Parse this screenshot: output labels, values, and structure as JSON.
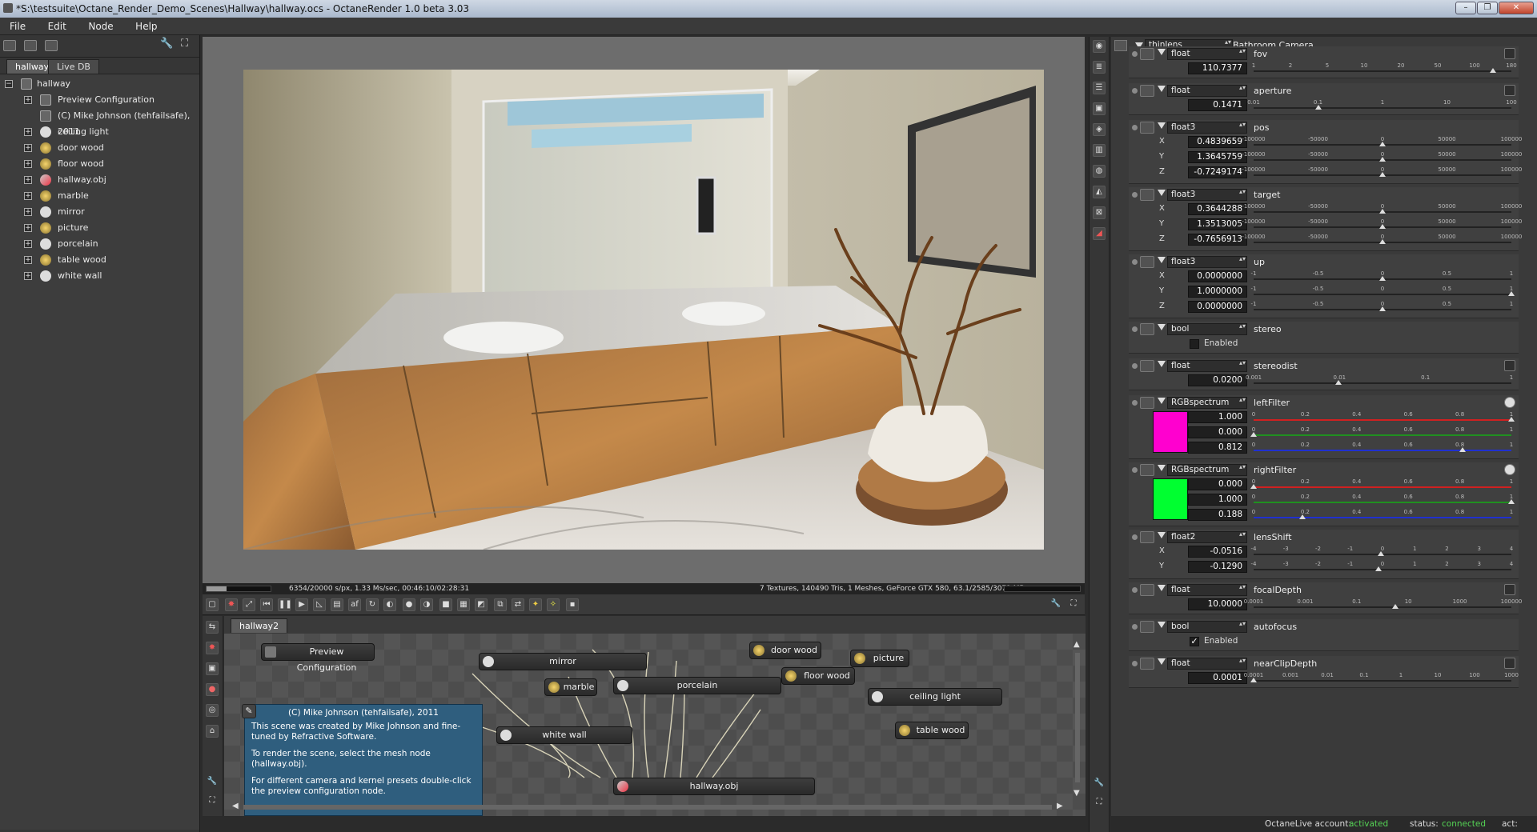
{
  "window": {
    "title": "*S:\\testsuite\\Octane_Render_Demo_Scenes\\Hallway\\hallway.ocs - OctaneRender 1.0 beta 3.03",
    "buttons": [
      "–",
      "❐",
      "✕"
    ]
  },
  "menu": [
    "File",
    "Edit",
    "Node",
    "Help"
  ],
  "left": {
    "tabs": [
      "hallway",
      "Live DB"
    ],
    "root": "hallway",
    "items": [
      {
        "label": "Preview Configuration",
        "icon": "config-node-icon",
        "expandable": true
      },
      {
        "label": "(C) Mike Johnson (tehfailsafe), 2011",
        "icon": "comment-icon",
        "expandable": false
      },
      {
        "label": "ceiling light",
        "icon": "material-sphere-icon",
        "expandable": true
      },
      {
        "label": "door wood",
        "icon": "texture-icon",
        "expandable": true
      },
      {
        "label": "floor wood",
        "icon": "texture-icon",
        "expandable": true
      },
      {
        "label": "hallway.obj",
        "icon": "mesh-icon",
        "expandable": true
      },
      {
        "label": "marble",
        "icon": "texture-icon",
        "expandable": true
      },
      {
        "label": "mirror",
        "icon": "material-sphere-icon",
        "expandable": true
      },
      {
        "label": "picture",
        "icon": "texture-icon",
        "expandable": true
      },
      {
        "label": "porcelain",
        "icon": "material-sphere-icon",
        "expandable": true
      },
      {
        "label": "table wood",
        "icon": "texture-icon",
        "expandable": true
      },
      {
        "label": "white wall",
        "icon": "material-sphere-icon",
        "expandable": true
      }
    ]
  },
  "viewport": {
    "status_left": "6354/20000 s/px, 1.33 Ms/sec, 00:46:10/02:28:31",
    "status_right": "7 Textures, 140490 Tris, 1 Meshes, GeForce GTX 580, 63.1/2585/3071 MB",
    "progress": 0.3177
  },
  "graph": {
    "tab": "hallway2",
    "nodes": [
      {
        "label": "Preview Configuration"
      },
      {
        "label": "mirror"
      },
      {
        "label": "door wood"
      },
      {
        "label": "picture"
      },
      {
        "label": "marble"
      },
      {
        "label": "porcelain"
      },
      {
        "label": "floor wood"
      },
      {
        "label": "ceiling light"
      },
      {
        "label": "white wall"
      },
      {
        "label": "table wood"
      },
      {
        "label": "hallway.obj"
      }
    ],
    "comment": {
      "title": "(C) Mike Johnson (tehfailsafe), 2011",
      "p1": "This scene was created by Mike Johnson and fine-tuned by Refractive Software.",
      "p2": "To render the scene, select the mesh node (hallway.obj).",
      "p3": "For different camera and kernel presets double-click the preview configuration node."
    }
  },
  "camera": {
    "type": "thinlens",
    "name": "Bathroom Camera"
  },
  "params": {
    "fov": {
      "type": "float",
      "name": "fov",
      "value": "110.7377",
      "ticks": [
        "1",
        "2",
        "5",
        "10",
        "20",
        "50",
        "100",
        "180"
      ]
    },
    "aperture": {
      "type": "float",
      "name": "aperture",
      "value": "0.1471",
      "ticks": [
        "0.01",
        "0.1",
        "1",
        "10",
        "100"
      ]
    },
    "pos": {
      "type": "float3",
      "name": "pos",
      "x": "0.4839659",
      "y": "1.3645759",
      "z": "-0.7249174"
    },
    "target": {
      "type": "float3",
      "name": "target",
      "x": "0.3644288",
      "y": "1.3513005",
      "z": "-0.7656913"
    },
    "up": {
      "type": "float3",
      "name": "up",
      "x": "0.0000000",
      "y": "1.0000000",
      "z": "0.0000000"
    },
    "stereo": {
      "type": "bool",
      "name": "stereo",
      "label": "Enabled",
      "checked": false
    },
    "stereodist": {
      "type": "float",
      "name": "stereodist",
      "value": "0.0200",
      "ticks": [
        "0.001",
        "0.01",
        "0.1",
        "1"
      ]
    },
    "leftFilter": {
      "type": "RGBspectrum",
      "name": "leftFilter",
      "r": "1.000",
      "g": "0.000",
      "b": "0.812",
      "color": "#ff00cf"
    },
    "rightFilter": {
      "type": "RGBspectrum",
      "name": "rightFilter",
      "r": "0.000",
      "g": "1.000",
      "b": "0.188",
      "color": "#00ff30"
    },
    "lensShift": {
      "type": "float2",
      "name": "lensShift",
      "x": "-0.0516",
      "y": "-0.1290",
      "ticks": [
        "-4",
        "-3",
        "-2",
        "-1",
        "0",
        "1",
        "2",
        "3",
        "4"
      ]
    },
    "focalDepth": {
      "type": "float",
      "name": "focalDepth",
      "value": "10.0000",
      "ticks": [
        "0.0001",
        "0.001",
        "0.1",
        "10",
        "1000",
        "100000"
      ]
    },
    "autofocus": {
      "type": "bool",
      "name": "autofocus",
      "label": "Enabled",
      "checked": true
    },
    "nearClipDepth": {
      "type": "float",
      "name": "nearClipDepth",
      "value": "0.0001",
      "ticks": [
        "0.0001",
        "0.001",
        "0.01",
        "0.1",
        "1",
        "10",
        "100",
        "1000"
      ]
    }
  },
  "axis": {
    "x": "X",
    "y": "Y",
    "z": "Z"
  },
  "ticks": {
    "pos": [
      "-100000",
      "-50000",
      "0",
      "50000",
      "100000"
    ],
    "up": [
      "-1",
      "-0.5",
      "0",
      "0.5",
      "1"
    ],
    "rgb": [
      "0",
      "0.2",
      "0.4",
      "0.6",
      "0.8",
      "1"
    ]
  },
  "status": {
    "account_label": "OctaneLive account:",
    "account_value": "activated",
    "status_label": "status:",
    "status_value": "connected",
    "act_label": "act:"
  },
  "colors": {
    "accent_green": "#55d455",
    "comment_bg": "#2f5e7e"
  }
}
